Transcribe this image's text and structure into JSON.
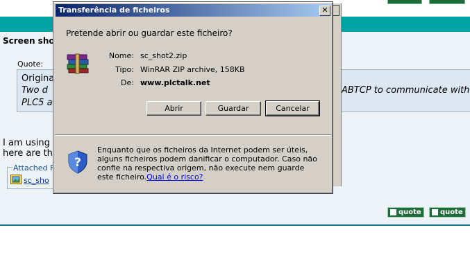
{
  "forum": {
    "post_title": "Screen sho",
    "quote_label": "Quote:",
    "quote_line1": "Origina",
    "quote_line2": "Two d",
    "quote_line3": "PLC5 a",
    "quote_right": "ABTCP to communicate with",
    "body_line1": "I am using",
    "body_line2": "here are th",
    "attached_legend": "Attached Fi",
    "attachment_link": "sc_sho",
    "quote_button_label": "quote",
    "quote_button2_label": "quote"
  },
  "dialog": {
    "title": "Transferência de ficheiros",
    "close_glyph": "✕",
    "question": "Pretende abrir ou guardar este ficheiro?",
    "name_label": "Nome:",
    "name_value": "sc_shot2.zip",
    "type_label": "Tipo:",
    "type_value": "WinRAR ZIP archive, 158KB",
    "from_label": "De:",
    "from_value": "www.plctalk.net",
    "open_button": "Abrir",
    "save_button": "Guardar",
    "cancel_button": "Cancelar",
    "warning_text": "Enquanto que os ficheiros da Internet podem ser úteis, alguns ficheiros podem danificar o computador. Caso não confie na respectiva origem, não execute nem guarde este ficheiro.",
    "risk_link": "Qual é o risco?"
  },
  "icons": {
    "file": "winrar-archive-icon",
    "shield": "security-shield-icon",
    "attachment": "attachment-image-icon"
  },
  "colors": {
    "teal_bar": "#00a3a3",
    "titlebar_start": "#0a246a",
    "titlebar_end": "#a6caf0",
    "quote_button": "#1f6b3c"
  }
}
